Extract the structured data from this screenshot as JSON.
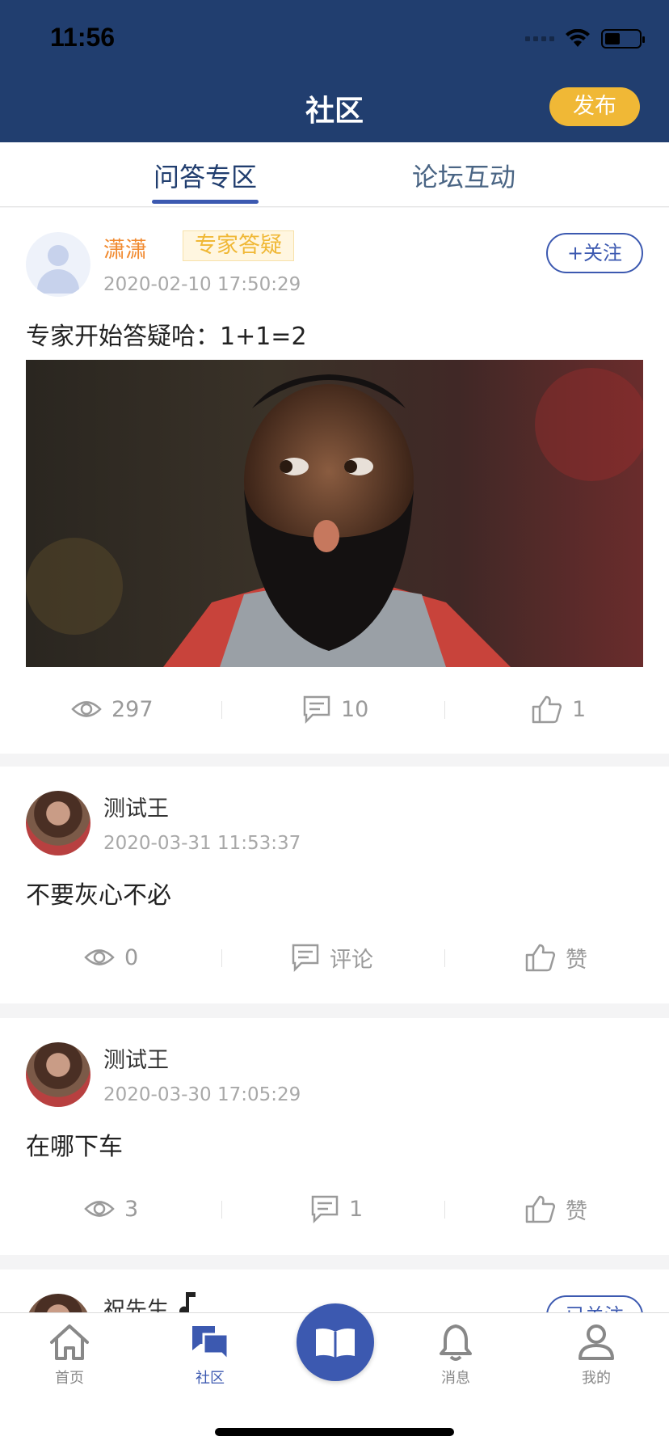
{
  "status_bar": {
    "time": "11:56"
  },
  "header": {
    "title": "社区",
    "publish_label": "发布"
  },
  "tabs": [
    {
      "label": "问答专区",
      "active": true
    },
    {
      "label": "论坛互动",
      "active": false
    }
  ],
  "posts": [
    {
      "username": "潇潇",
      "badge": "专家答疑",
      "time": "2020-02-10 17:50:29",
      "follow_label": "+关注",
      "text": "专家开始答疑哈：1+1=2",
      "views": "297",
      "comments": "10",
      "likes": "1"
    },
    {
      "username": "测试王",
      "time": "2020-03-31 11:53:37",
      "text": "不要灰心不必",
      "views": "0",
      "comments": "评论",
      "likes": "赞"
    },
    {
      "username": "测试王",
      "time": "2020-03-30 17:05:29",
      "text": "在哪下车",
      "views": "3",
      "comments": "1",
      "likes": "赞"
    },
    {
      "username": "祝先生",
      "follow_label": "已关注"
    }
  ],
  "bottom_nav": [
    {
      "label": "首页",
      "icon": "home-icon"
    },
    {
      "label": "社区",
      "icon": "community-icon",
      "active": true
    },
    {
      "label": "",
      "icon": "book-icon"
    },
    {
      "label": "消息",
      "icon": "bell-icon"
    },
    {
      "label": "我的",
      "icon": "user-icon"
    }
  ],
  "colors": {
    "header_bg": "#213e6f",
    "accent": "#3c59b0",
    "publish_bg": "#f0b836",
    "username_orange": "#f18a2f"
  }
}
